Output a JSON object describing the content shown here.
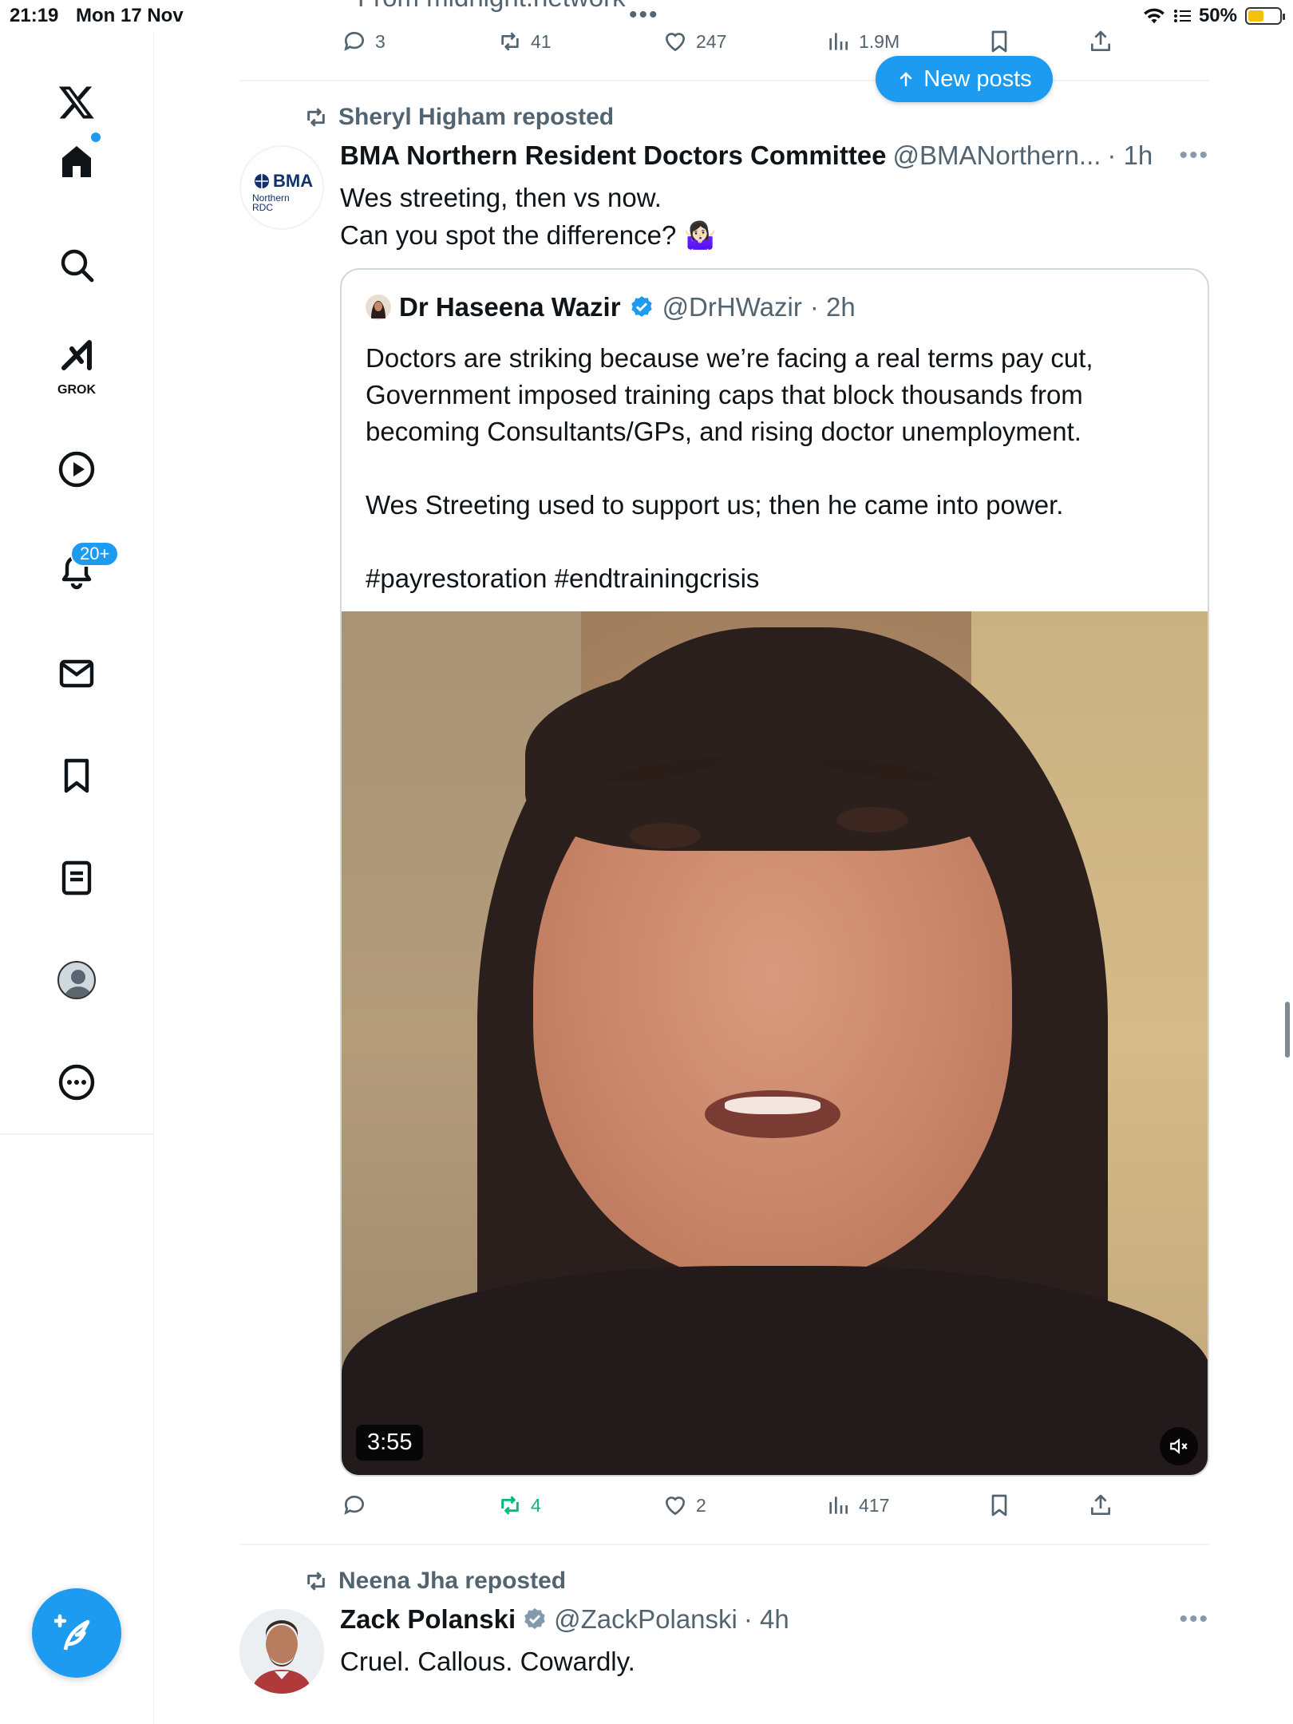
{
  "status_bar": {
    "time": "21:19",
    "date": "Mon 17 Nov",
    "battery": "50%",
    "battery_level": 0.5
  },
  "sidebar": {
    "grok_label": "GROK",
    "notifications_badge": "20+",
    "icons": [
      "x-logo-icon",
      "home-icon",
      "search-icon",
      "grok-icon",
      "video-icon",
      "bell-icon",
      "mail-icon",
      "bookmark-icon",
      "lists-icon",
      "profile-icon",
      "more-icon",
      "compose-icon"
    ]
  },
  "previous_post": {
    "partial_text": "From midnight.network",
    "replies": "3",
    "reposts": "41",
    "likes": "247",
    "views": "1.9M"
  },
  "new_posts_button": "New posts",
  "post1": {
    "repost_by": "Sheryl Higham reposted",
    "avatar_brand": "BMA",
    "avatar_sub": "Northern\nRDC",
    "name": "BMA Northern Resident Doctors Committee",
    "handle": "@BMANorthern...",
    "time": "· 1h",
    "text_line1": "Wes streeting, then vs now.",
    "text_line2": "Can you spot the difference? 🤷🏻‍♀️",
    "quote": {
      "name": "Dr Haseena Wazir",
      "handle": "@DrHWazir",
      "time": "· 2h",
      "text": "Doctors are striking because we’re facing a real terms pay cut, Government imposed training caps that block thousands from becoming Consultants/GPs, and rising doctor unemployment.\n\nWes Streeting used to support us; then he came into power.\n\n#payrestoration #endtrainingcrisis",
      "video_duration": "3:55"
    },
    "replies": "",
    "reposts": "4",
    "likes": "2",
    "views": "417"
  },
  "post2": {
    "repost_by": "Neena Jha reposted",
    "name": "Zack Polanski",
    "handle": "@ZackPolanski",
    "time": "· 4h",
    "text": "Cruel. Callous. Cowardly."
  },
  "colors": {
    "accent": "#1d9bf0",
    "repost_green": "#00ba7c",
    "muted": "#536471"
  }
}
